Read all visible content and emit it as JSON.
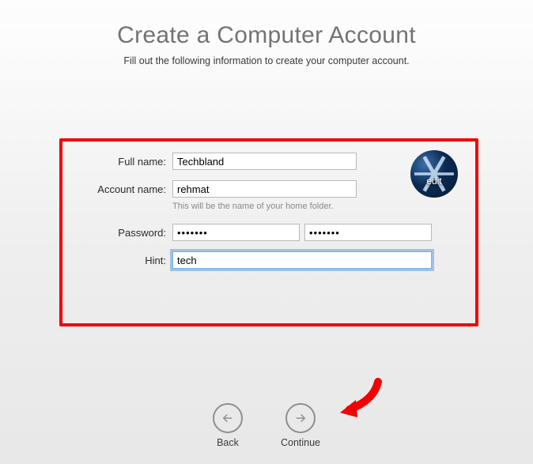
{
  "header": {
    "title": "Create a Computer Account",
    "subtitle": "Fill out the following information to create your computer account."
  },
  "form": {
    "full_name": {
      "label": "Full name:",
      "value": "Techbland"
    },
    "account_name": {
      "label": "Account name:",
      "value": "rehmat",
      "helper": "This will be the name of your home folder."
    },
    "password": {
      "label": "Password:",
      "value": "•••••••",
      "verify_value": "•••••••"
    },
    "hint": {
      "label": "Hint:",
      "value": "tech"
    },
    "avatar": {
      "edit_label": "edit"
    }
  },
  "nav": {
    "back": "Back",
    "continue": "Continue"
  }
}
